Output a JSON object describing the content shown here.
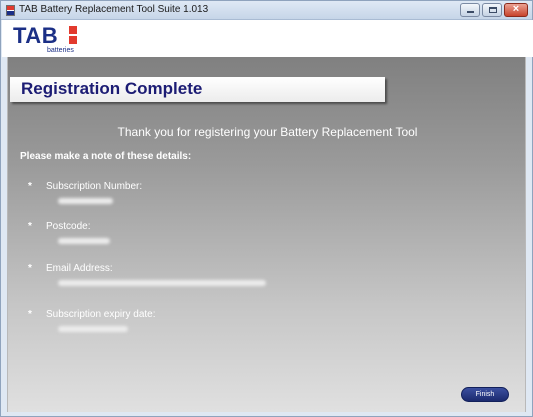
{
  "window": {
    "title": "TAB Battery Replacement Tool Suite 1.013",
    "controls": {
      "minimize": "",
      "maximize": "",
      "close": "×"
    }
  },
  "logo": {
    "brand": "TAB",
    "sub": "batteries"
  },
  "page": {
    "heading": "Registration Complete",
    "thanks": "Thank you for registering your Battery Replacement Tool",
    "note": "Please make a note of these details:",
    "bullet": "*",
    "details": [
      {
        "label": "Subscription Number:",
        "value_redacted": true
      },
      {
        "label": "Postcode:",
        "value_redacted": true
      },
      {
        "label": "Email Address:",
        "value_redacted": true
      },
      {
        "label": "Subscription expiry date:",
        "value_redacted": true
      }
    ],
    "finish_label": "Finish"
  },
  "colors": {
    "heading_text": "#1c1c74",
    "brand_blue": "#1b2f86",
    "brand_red": "#e23a2e",
    "button": "#2a3b85"
  }
}
